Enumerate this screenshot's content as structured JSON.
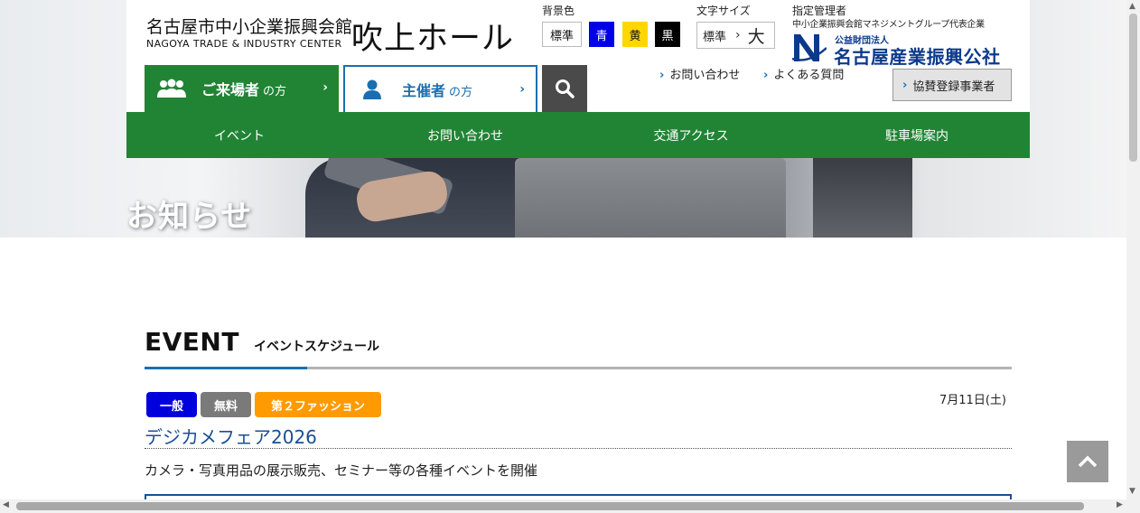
{
  "header": {
    "org_name": "名古屋市中小企業振興会館",
    "org_name_en": "NAGOYA TRADE & INDUSTRY CENTER",
    "hall_name": "吹上ホール",
    "bg_color": {
      "label": "背景色",
      "options": [
        "標準",
        "青",
        "黄",
        "黒"
      ]
    },
    "font_size": {
      "label": "文字サイズ",
      "normal": "標準",
      "arrow": "›",
      "large": "大"
    },
    "manager": {
      "label": "指定管理者",
      "sub": "中小企業振興会館マネジメントグループ代表企業",
      "corp_small": "公益財団法人",
      "corp_name": "名古屋産業振興公社"
    },
    "tabs": {
      "visitor_main": "ご来場者",
      "visitor_suffix": "の方",
      "organizer_main": "主催者",
      "organizer_suffix": "の方",
      "chevron": "›"
    },
    "links": {
      "contact": "お問い合わせ",
      "faq": "よくある質問",
      "partner": "協賛登録事業者",
      "chevron": "›"
    },
    "colors": {
      "brand_green": "#218435",
      "brand_blue": "#1a6fb0"
    }
  },
  "global_nav": [
    "イベント",
    "お問い合わせ",
    "交通アクセス",
    "駐車場案内"
  ],
  "hero": {
    "title": "お知らせ"
  },
  "event_section": {
    "title": "EVENT",
    "subtitle": "イベントスケジュール",
    "items": [
      {
        "badges": [
          "一般",
          "無料",
          "第２ファッション"
        ],
        "date": "7月11日(土)",
        "name": "デジカメフェア2026",
        "description": "カメラ・写真用品の展示販売、セミナー等の各種イベントを開催"
      }
    ]
  },
  "icons": {
    "visitor": "people-icon",
    "organizer": "person-icon",
    "search": "search-icon",
    "totop": "chevron-up-icon"
  }
}
